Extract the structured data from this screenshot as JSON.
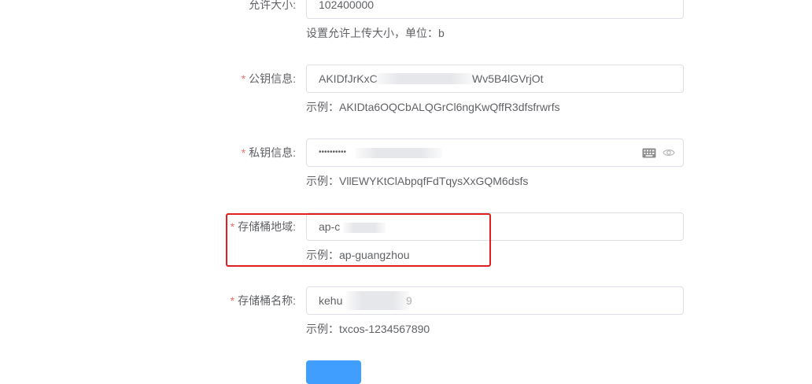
{
  "form": {
    "size_limit": {
      "label": "允许大小:",
      "value": "102400000",
      "hint": "设置允许上传大小，单位：b"
    },
    "public_key": {
      "label": "公钥信息:",
      "value_prefix": "AKIDfJrKxC",
      "value_suffix": "Wv5B4lGVrjOt",
      "hint": "示例：AKIDta6OQCbALQGrCl6ngKwQffR3dfsfrwrfs"
    },
    "private_key": {
      "label": "私钥信息:",
      "value": "••••••••••",
      "hint": "示例：VllEWYKtClAbpqfFdTqysXxGQM6dsfs",
      "keyboard_icon": "keyboard-icon",
      "eye_icon": "eye-icon"
    },
    "bucket_region": {
      "label": "存储桶地域:",
      "value": "ap-c",
      "hint": "示例：ap-guangzhou"
    },
    "bucket_name": {
      "label": "存储桶名称:",
      "value_prefix": "kehu",
      "value_suffix": "9",
      "hint": "示例：txcos-1234567890"
    },
    "required_mark": "*"
  },
  "colors": {
    "required": "#f56c6c",
    "highlight_border": "#e02020",
    "primary_button": "#409eff",
    "input_border": "#dcdfe6",
    "text": "#606266"
  }
}
